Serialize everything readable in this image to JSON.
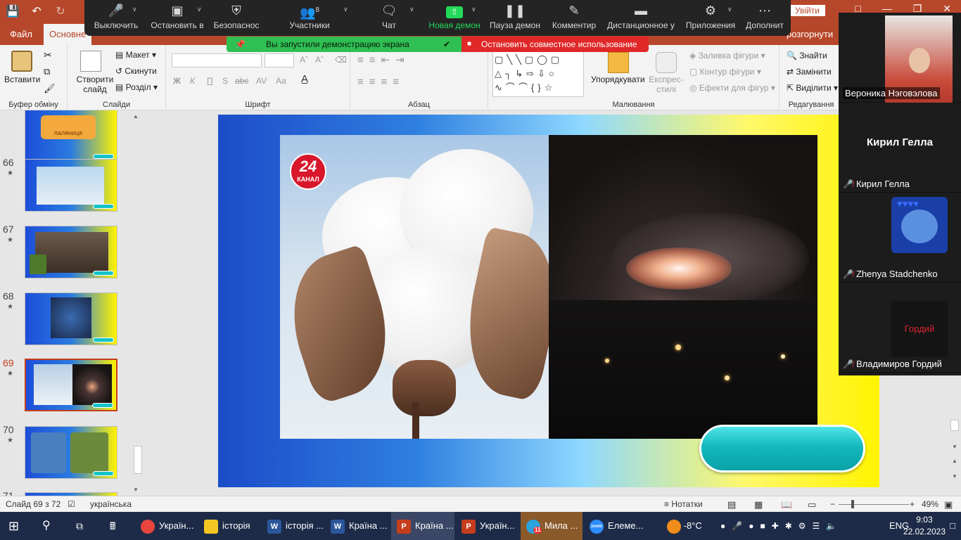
{
  "app": {
    "accent": "#b7472a",
    "signin": "Увійти"
  },
  "ribbon": {
    "tabs": [
      {
        "label": "Файл"
      },
      {
        "label": "Основне"
      },
      {
        "label": "розгорнути"
      }
    ],
    "clipboard": {
      "paste": "Вставити",
      "label": "Буфер обміну"
    },
    "slides": {
      "new_slide": "Створити слайд",
      "layout": "Макет",
      "reset": "Скинути",
      "section": "Розділ",
      "label": "Слайди"
    },
    "font": {
      "bold": "Ж",
      "italic": "К",
      "underline": "П",
      "shadow": "S",
      "strike": "abc",
      "spacing": "AV",
      "case": "Aa",
      "grow": "A",
      "shrink": "A",
      "label": "Шрифт"
    },
    "paragraph": {
      "label": "Абзац"
    },
    "drawing": {
      "arrange": "Упорядкувати",
      "quick_styles": "Експрес-стилі",
      "fill": "Заливка фігури",
      "outline": "Контур фігури",
      "effects": "Ефекти для фігур",
      "label": "Малювання"
    },
    "editing": {
      "find": "Знайти",
      "replace": "Замінити",
      "select": "Виділити",
      "label": "Редагування"
    }
  },
  "zoom": {
    "toolbar": [
      {
        "label": "Выключить",
        "icon": "microphone-icon"
      },
      {
        "label": "Остановить в",
        "icon": "video-camera-icon"
      },
      {
        "label": "Безопаснос",
        "icon": "shield-icon"
      },
      {
        "label": "Участники",
        "icon": "participants-icon",
        "count": "8"
      },
      {
        "label": "Чат",
        "icon": "chat-icon"
      },
      {
        "label": "Новая демон",
        "icon": "share-screen-icon"
      },
      {
        "label": "Пауза демон",
        "icon": "pause-icon"
      },
      {
        "label": "Комментир",
        "icon": "pen-icon"
      },
      {
        "label": "Дистанционное у",
        "icon": "mouse-icon"
      },
      {
        "label": "Приложения",
        "icon": "apps-icon"
      },
      {
        "label": "Дополнит",
        "icon": "more-icon"
      }
    ],
    "share_notice": "Вы запустили демонстрацию экрана",
    "stop_share": "Остановить совместное использование",
    "participants": [
      {
        "name": "Вероника Нэговэлова"
      },
      {
        "name": "Кирил Гелла",
        "display": "Кирил Гелла"
      },
      {
        "name": "Zhenya Stadchenko"
      },
      {
        "name": "Владимиров Гордий",
        "avatar_text": "Гордий"
      }
    ]
  },
  "slides_panel": {
    "items": [
      {
        "num": "",
        "star": ""
      },
      {
        "num": "66",
        "star": "★"
      },
      {
        "num": "67",
        "star": "★"
      },
      {
        "num": "68",
        "star": "★"
      },
      {
        "num": "69",
        "star": "★"
      },
      {
        "num": "70",
        "star": "★"
      },
      {
        "num": "71",
        "star": ""
      }
    ],
    "selected": "69"
  },
  "slide": {
    "logo_text": "24",
    "logo_sub": "КАНАЛ",
    "thumb1_text": "паляниця"
  },
  "statusbar": {
    "slide_info": "Слайд 69 з 72",
    "language": "українська",
    "notes": "Нотатки",
    "zoom": "49%"
  },
  "taskbar": {
    "items": [
      {
        "label": "Україн...",
        "icon": "chrome-icon",
        "color": "#e8453c"
      },
      {
        "label": "історія",
        "icon": "folder-icon",
        "color": "#f3c623"
      },
      {
        "label": "історія ...",
        "icon": "word-icon",
        "color": "#2b579a"
      },
      {
        "label": "Країна ...",
        "icon": "word-icon",
        "color": "#2b579a"
      },
      {
        "label": "Країна ...",
        "icon": "powerpoint-icon",
        "color": "#c43e1c"
      },
      {
        "label": "Україн...",
        "icon": "powerpoint-icon",
        "color": "#c43e1c"
      },
      {
        "label": "Мила ...",
        "icon": "telegram-icon",
        "color": "#2aa3df",
        "badge": "11"
      },
      {
        "label": "Елеме...",
        "icon": "zoom-icon",
        "color": "#2d8cff"
      }
    ],
    "weather": "-8°C",
    "lang": "ENG",
    "time": "9:03",
    "date": "22.02.2023"
  }
}
